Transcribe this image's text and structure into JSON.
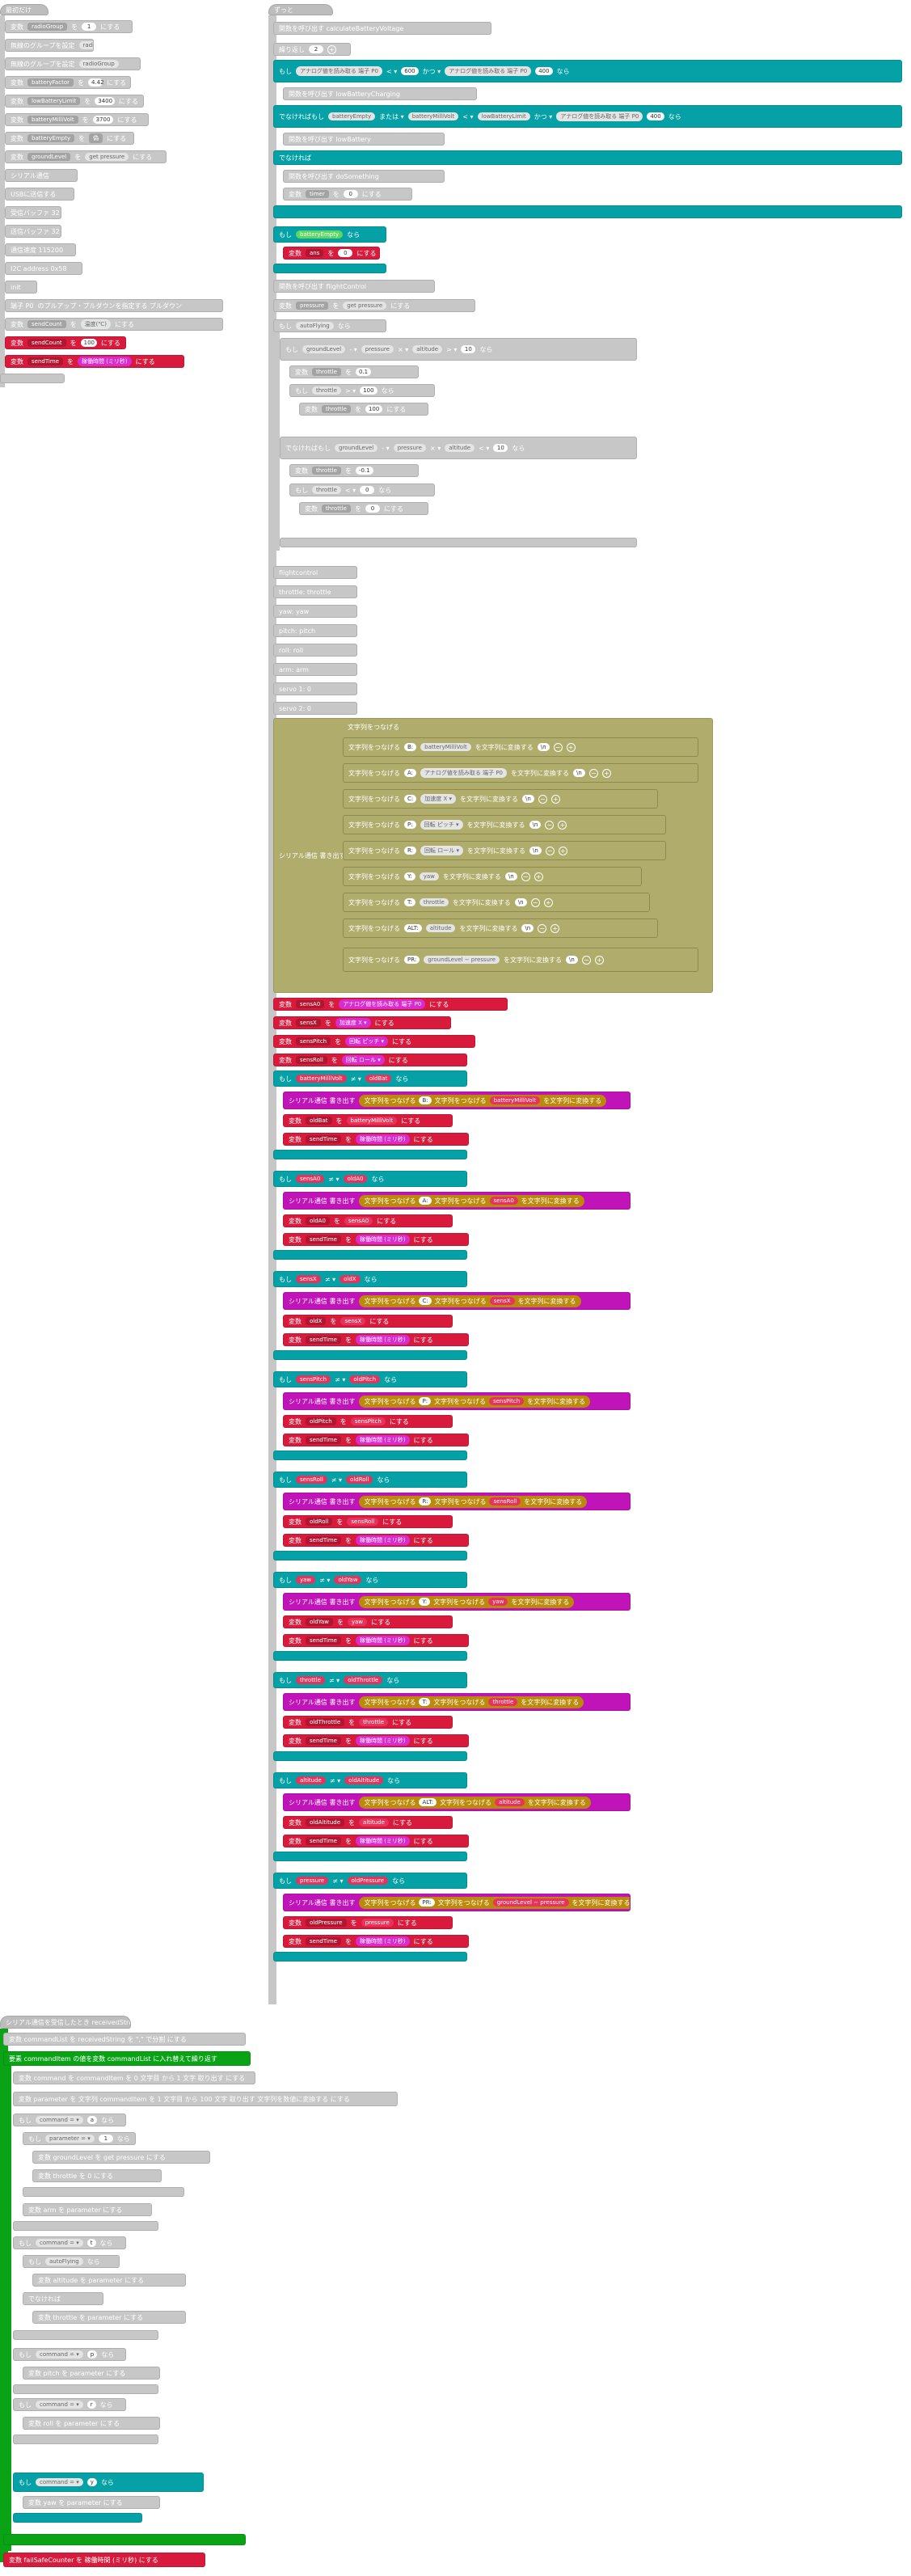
{
  "left_column": {
    "items": [
      {
        "label": "最初だけ"
      },
      {
        "label": "変数",
        "var": "radioGroup",
        "op": "を",
        "value": "1",
        "suffix": "にする"
      },
      {
        "label": "無線のグループを設定",
        "value": "radioGroup"
      },
      {
        "label": "無線のグループを設定",
        "value": "radioGroup"
      },
      {
        "label": "変数",
        "var": "batteryFactor",
        "op": "を",
        "value": "4.42",
        "suffix": "にする"
      },
      {
        "label": "変数",
        "var": "lowBatteryLimit",
        "op": "を",
        "value": "3400",
        "suffix": "にする"
      },
      {
        "label": "変数",
        "var": "batteryMilliVolt",
        "op": "を",
        "value": "3700",
        "suffix": "にする"
      },
      {
        "label": "変数",
        "var": "batteryEmpty",
        "op": "を",
        "value": "偽",
        "suffix": "にする"
      },
      {
        "label": "変数",
        "var": "groundLevel",
        "op": "を",
        "value": "get pressure",
        "suffix": "にする"
      },
      {
        "label": "シリアル通信"
      },
      {
        "label": "USBに送信する"
      },
      {
        "label": "通信速度 115200"
      },
      {
        "label": "受信バッファ 32"
      },
      {
        "label": "送信バッファ 32"
      },
      {
        "label": "通信速度 115200"
      },
      {
        "label": "I2C address 0x58"
      },
      {
        "label": "init"
      },
      {
        "label": "端子 P0",
        "extra": "のプルアップ・プルダウンを指定する プルダウン"
      },
      {
        "label": "変数",
        "var": "sendCount",
        "op": "を",
        "value": "温度(℃)",
        "suffix": "にする"
      },
      {
        "label": "変数",
        "var": "sendCount",
        "op": "を",
        "value": "100",
        "suffix": "にする"
      },
      {
        "label": "変数",
        "var": "sendTime",
        "op": "を",
        "value": "稼働時間 (ミリ秒)",
        "suffix": "にする"
      }
    ]
  },
  "battery_fn": {
    "header": "ずっと",
    "call": "関数を呼び出す calculateBatteryVoltage",
    "loop": "繰り返し",
    "loop_count": "2",
    "if": "もし",
    "else_if": "でなければもし",
    "else": "でなければ",
    "then": "なら",
    "cond1_left": "アナログ値を読み取る 端子 P0",
    "cond1_op": "< ▾",
    "cond1_val": "600",
    "cond1_join": "かつ ▾",
    "cond1_right": "アナログ値を読み取る 端子 P0",
    "cond1_val2": "400",
    "call2": "関数を呼び出す lowBatteryCharging",
    "cond2_left": "batteryEmpty",
    "cond2_op": "または ▾",
    "cond2_mid": "batteryMilliVolt",
    "cond2_lt": "< ▾",
    "cond2_right": "lowBatteryLimit",
    "cond2_join": "かつ ▾",
    "cond2_analog": "アナログ値を読み取る 端子 P0",
    "cond2_val": "400",
    "call3": "関数を呼び出す lowBattery",
    "call4": "関数を呼び出す doSomething",
    "set_var": "変数",
    "var_timer": "timer",
    "op_wo": "を",
    "zero": "0",
    "suffix": "にする",
    "empty_flag": "batteryEmpty",
    "set_ans": "ans",
    "ans_val": "0",
    "fn_flightctl": "関数を呼び出す flightControl",
    "var_pressure": "pressure",
    "get_pressure": "get pressure",
    "ctl_flag": "autoFlying",
    "gl": "groundLevel",
    "minus": "- ▾",
    "pr": "pressure",
    "mul": "× ▾",
    "alt": "altitude",
    "gt": "> ▾",
    "alt_val1": "10",
    "throttle": "throttle",
    "th_a": "0.1",
    "th_b": "100",
    "th_c": "100",
    "lt": "< ▾",
    "alt_val2": "10",
    "th_d": "-0.1",
    "th_e": "0",
    "th_f": "0",
    "fn_flight": "flightcontrol",
    "params": [
      "throttle: throttle",
      "yaw: yaw",
      "pitch: pitch",
      "roll: roll",
      "arm: arm",
      "servo 1: 0",
      "servo 2: 0"
    ],
    "join_label": "文字列をつなげる",
    "join_rows": [
      {
        "prefix": "B:",
        "mid": "batteryMilliVolt",
        "post": "を文字列に変換する",
        "extra": "\\n"
      },
      {
        "prefix": "A:",
        "mid": "アナログ値を読み取る 端子 P0",
        "post": "を文字列に変換する",
        "extra": "\\n"
      },
      {
        "prefix": "C:",
        "mid": "加速度 X ▾",
        "post": "を文字列に変換する",
        "extra": "\\n"
      },
      {
        "prefix": "P:",
        "mid": "回転 ピッチ ▾",
        "post": "を文字列に変換する",
        "extra": "\\n"
      },
      {
        "prefix": "R:",
        "mid": "回転 ロール ▾",
        "post": "を文字列に変換する",
        "extra": "\\n"
      },
      {
        "prefix": "Y:",
        "mid": "yaw",
        "post": "を文字列に変換する",
        "extra": "\\n"
      },
      {
        "prefix": "T:",
        "mid": "throttle",
        "post": "を文字列に変換する",
        "extra": "\\n"
      },
      {
        "prefix": "ALT:",
        "mid": "altitude",
        "post": "を文字列に変換する",
        "extra": "\\n"
      },
      {
        "prefix": "PR:",
        "mid": "groundLevel − pressure",
        "post": "を文字列に変換する",
        "extra": "\\n"
      }
    ],
    "serial_send": "シリアル通信 書き出す",
    "red_sets": [
      {
        "var": "sensA0",
        "val": "アナログ値を読み取る 端子 P0"
      },
      {
        "var": "sensX",
        "val": "加速度 X ▾"
      },
      {
        "var": "sensPitch",
        "val": "回転 ピッチ ▾"
      },
      {
        "var": "sensRoll",
        "val": "回転 ロール ▾"
      }
    ],
    "checks": [
      {
        "cmp": "batteryMilliVolt",
        "old": "oldBat",
        "prefix": "B:",
        "send": "batteryMilliVolt"
      },
      {
        "cmp": "sensA0",
        "old": "oldA0",
        "prefix": "A:",
        "send": "sensA0"
      },
      {
        "cmp": "sensX",
        "old": "oldX",
        "prefix": "C:",
        "send": "sensX"
      },
      {
        "cmp": "sensPitch",
        "old": "oldPitch",
        "prefix": "P:",
        "send": "sensPitch"
      },
      {
        "cmp": "sensRoll",
        "old": "oldRoll",
        "prefix": "R:",
        "send": "sensRoll"
      },
      {
        "cmp": "yaw",
        "old": "oldYaw",
        "prefix": "Y:",
        "send": "yaw"
      },
      {
        "cmp": "throttle",
        "old": "oldThrottle",
        "prefix": "T:",
        "send": "throttle"
      },
      {
        "cmp": "altitude",
        "old": "oldAltitude",
        "prefix": "ALT:",
        "send": "altitude"
      },
      {
        "cmp": "pressure",
        "old": "oldPressure",
        "prefix": "PR:",
        "send": "groundLevel − pressure"
      }
    ],
    "ne": "≠ ▾",
    "send_time": "sendTime",
    "uptime": "稼働時間 (ミリ秒)"
  },
  "serial_handler": {
    "header": "シリアル通信を受信したとき receivedString",
    "set_cmd": "変数 commandList を receivedString を \",\" で分割 にする",
    "foreach": "要素 commandItem の値を変数 commandList に入れ替えて繰り返す",
    "set_command": "変数 command を commandItem を 0 文字目 から 1 文字 取り出す にする",
    "set_param": "変数 parameter を 文字列 commandItem を 1 文字目 から 100 文字 取り出す 文字列を数値に変換する にする",
    "if": "もし",
    "then": "なら",
    "else": "でなければ",
    "cmd_eq": "command = ▾",
    "c1": "a",
    "c2": "t",
    "c3": "p",
    "c4": "r",
    "c5": "y",
    "param_eq": "parameter = ▾",
    "one": "1",
    "gl_set": "変数 groundLevel を get pressure にする",
    "th_set": "変数 throttle を 0 にする",
    "arm_set": "変数 arm を parameter にする",
    "auto_flag": "autoFlying",
    "alt_set": "変数 altitude を parameter にする",
    "th_set2": "変数 throttle を parameter にする",
    "pitch_set": "変数 pitch を parameter にする",
    "roll_set": "変数 roll を parameter にする",
    "yaw_set": "変数 yaw を parameter にする",
    "failsafe": "変数 failSafeCounter を 稼働時間 (ミリ秒) にする"
  }
}
